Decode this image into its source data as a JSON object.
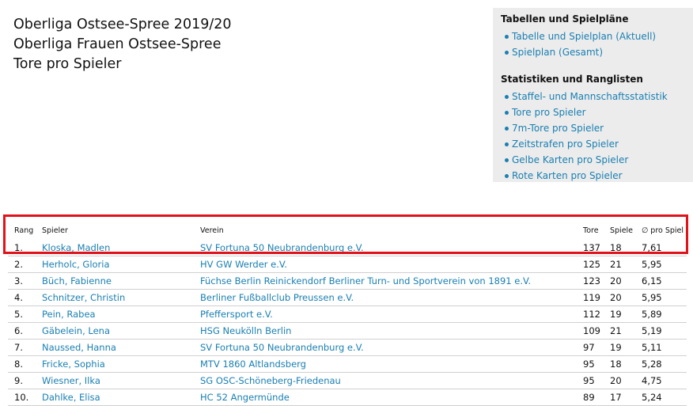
{
  "titles": {
    "line1": "Oberliga Ostsee-Spree 2019/20",
    "line2": "Oberliga Frauen Ostsee-Spree",
    "line3": "Tore pro Spieler"
  },
  "sidebox": {
    "heading1": "Tabellen und Spielpläne",
    "links1": [
      "Tabelle und Spielplan (Aktuell)",
      "Spielplan (Gesamt)"
    ],
    "heading2": "Statistiken und Ranglisten",
    "links2": [
      "Staffel- und Mannschaftsstatistik",
      "Tore pro Spieler",
      "7m-Tore pro Spieler",
      "Zeitstrafen pro Spieler",
      "Gelbe Karten pro Spieler",
      "Rote Karten pro Spieler"
    ]
  },
  "table": {
    "headers": [
      "Rang",
      "Spieler",
      "Verein",
      "Tore",
      "Spiele",
      "∅ pro Spiel"
    ],
    "rows": [
      {
        "rang": "1.",
        "spieler": "Kloska, Madlen",
        "verein": "SV Fortuna 50 Neubrandenburg e.V.",
        "tore": "137",
        "spiele": "18",
        "pro": "7,61"
      },
      {
        "rang": "2.",
        "spieler": "Herholc, Gloria",
        "verein": "HV GW Werder e.V.",
        "tore": "125",
        "spiele": "21",
        "pro": "5,95"
      },
      {
        "rang": "3.",
        "spieler": "Büch, Fabienne",
        "verein": "Füchse Berlin Reinickendorf Berliner Turn- und Sportverein von 1891 e.V.",
        "tore": "123",
        "spiele": "20",
        "pro": "6,15"
      },
      {
        "rang": "4.",
        "spieler": "Schnitzer, Christin",
        "verein": "Berliner Fußballclub Preussen e.V.",
        "tore": "119",
        "spiele": "20",
        "pro": "5,95"
      },
      {
        "rang": "5.",
        "spieler": "Pein, Rabea",
        "verein": "Pfeffersport e.V.",
        "tore": "112",
        "spiele": "19",
        "pro": "5,89"
      },
      {
        "rang": "6.",
        "spieler": "Gäbelein, Lena",
        "verein": "HSG Neukölln Berlin",
        "tore": "109",
        "spiele": "21",
        "pro": "5,19"
      },
      {
        "rang": "7.",
        "spieler": "Naussed, Hanna",
        "verein": "SV Fortuna 50 Neubrandenburg e.V.",
        "tore": "97",
        "spiele": "19",
        "pro": "5,11"
      },
      {
        "rang": "8.",
        "spieler": "Fricke, Sophia",
        "verein": "MTV 1860 Altlandsberg",
        "tore": "95",
        "spiele": "18",
        "pro": "5,28"
      },
      {
        "rang": "9.",
        "spieler": "Wiesner, Ilka",
        "verein": "SG OSC-Schöneberg-Friedenau",
        "tore": "95",
        "spiele": "20",
        "pro": "4,75"
      },
      {
        "rang": "10.",
        "spieler": "Dahlke, Elisa",
        "verein": "HC 52 Angermünde",
        "tore": "89",
        "spiele": "17",
        "pro": "5,24"
      }
    ]
  },
  "colors": {
    "link": "#1a7fb1",
    "highlight": "#e0131b",
    "sidebox_bg": "#ececec"
  }
}
